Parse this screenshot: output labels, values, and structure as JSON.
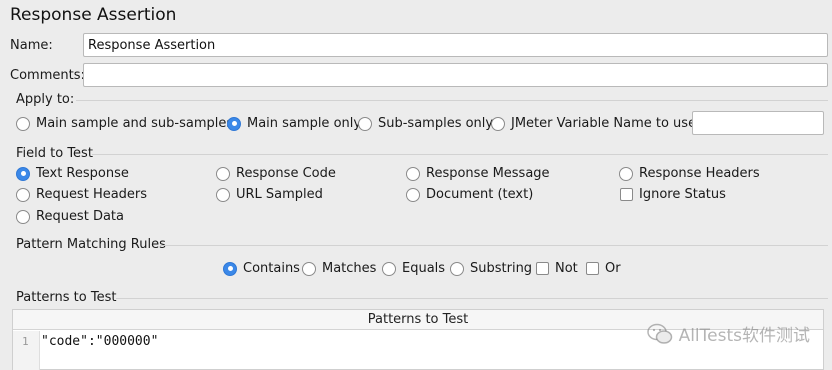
{
  "window": {
    "title": "Response Assertion"
  },
  "name_field": {
    "label": "Name:",
    "value": "Response Assertion"
  },
  "comments_field": {
    "label": "Comments:",
    "value": ""
  },
  "apply_to": {
    "heading": "Apply to:",
    "options": [
      {
        "label": "Main sample and sub-samples",
        "selected": false
      },
      {
        "label": "Main sample only",
        "selected": true
      },
      {
        "label": "Sub-samples only",
        "selected": false
      },
      {
        "label": "JMeter Variable Name to use",
        "selected": false
      }
    ],
    "variable_value": ""
  },
  "field_to_test": {
    "heading": "Field to Test",
    "options": [
      {
        "label": "Text Response",
        "selected": true
      },
      {
        "label": "Response Code",
        "selected": false
      },
      {
        "label": "Response Message",
        "selected": false
      },
      {
        "label": "Response Headers",
        "selected": false
      },
      {
        "label": "Request Headers",
        "selected": false
      },
      {
        "label": "URL Sampled",
        "selected": false
      },
      {
        "label": "Document (text)",
        "selected": false
      },
      {
        "label": "Ignore Status",
        "checked": false
      },
      {
        "label": "Request Data",
        "selected": false
      }
    ]
  },
  "pattern_matching": {
    "heading": "Pattern Matching Rules",
    "options": [
      {
        "label": "Contains",
        "selected": true
      },
      {
        "label": "Matches",
        "selected": false
      },
      {
        "label": "Equals",
        "selected": false
      },
      {
        "label": "Substring",
        "selected": false
      },
      {
        "label": "Not",
        "checked": false
      },
      {
        "label": "Or",
        "checked": false
      }
    ]
  },
  "patterns": {
    "heading": "Patterns to Test",
    "column_header": "Patterns to Test",
    "rows": [
      {
        "line": "1",
        "value": "\"code\":\"000000\""
      }
    ]
  },
  "watermark": {
    "text": "AllTests软件测试"
  },
  "colors": {
    "background": "#ececec",
    "radio_selected": "#3b88e8"
  }
}
